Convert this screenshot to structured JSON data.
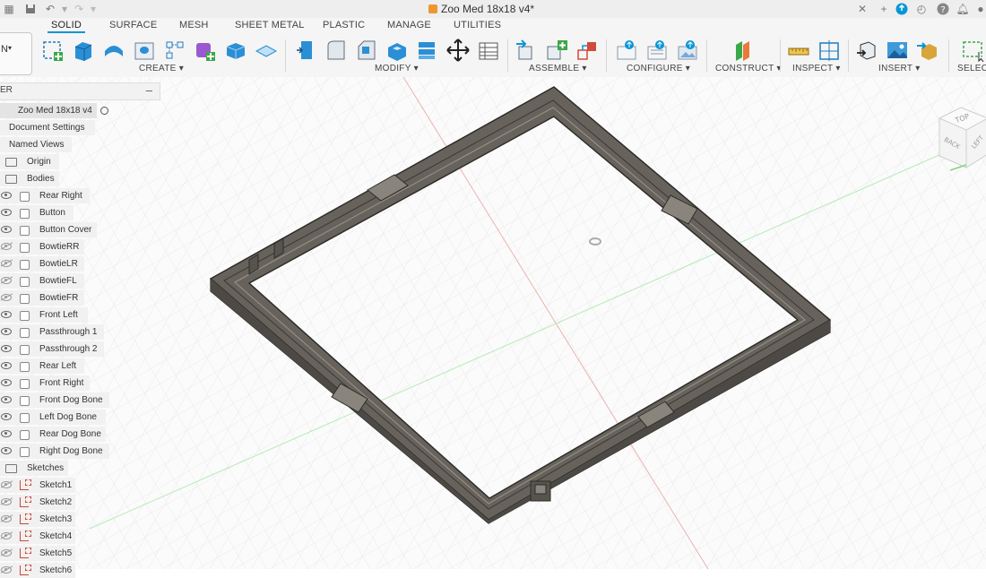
{
  "titlebar": {
    "document_title": "Zoo Med 18x18 v4*"
  },
  "tabs": [
    {
      "label": "SOLID",
      "active": true
    },
    {
      "label": "SURFACE"
    },
    {
      "label": "MESH"
    },
    {
      "label": "SHEET METAL"
    },
    {
      "label": "PLASTIC"
    },
    {
      "label": "MANAGE"
    },
    {
      "label": "UTILITIES"
    }
  ],
  "toolbar": {
    "workspace_label": "N",
    "groups": [
      {
        "label": "CREATE"
      },
      {
        "label": "MODIFY"
      },
      {
        "label": "ASSEMBLE"
      },
      {
        "label": "CONFIGURE"
      },
      {
        "label": "CONSTRUCT"
      },
      {
        "label": "INSPECT"
      },
      {
        "label": "INSERT"
      },
      {
        "label": "SELECT"
      }
    ]
  },
  "browser": {
    "header_label": "ER",
    "root": "Zoo Med 18x18 v4",
    "items": [
      {
        "label": "Document Settings"
      },
      {
        "label": "Named Views"
      },
      {
        "label": "Origin"
      },
      {
        "label": "Bodies"
      }
    ],
    "bodies": [
      {
        "label": "Rear Right",
        "visible": true
      },
      {
        "label": "Button",
        "visible": true
      },
      {
        "label": "Button Cover",
        "visible": true
      },
      {
        "label": "BowtieRR",
        "visible": false
      },
      {
        "label": "BowtieLR",
        "visible": false
      },
      {
        "label": "BowtieFL",
        "visible": false
      },
      {
        "label": "BowtieFR",
        "visible": false
      },
      {
        "label": "Front Left",
        "visible": true
      },
      {
        "label": "Passthrough 1",
        "visible": true
      },
      {
        "label": "Passthrough 2",
        "visible": true
      },
      {
        "label": "Rear Left",
        "visible": true
      },
      {
        "label": "Front Right",
        "visible": true
      },
      {
        "label": "Front Dog Bone",
        "visible": true
      },
      {
        "label": "Left Dog Bone",
        "visible": true
      },
      {
        "label": "Rear Dog Bone",
        "visible": true
      },
      {
        "label": "Right Dog Bone",
        "visible": true
      }
    ],
    "sketches_label": "Sketches",
    "sketches": [
      {
        "label": "Sketch1"
      },
      {
        "label": "Sketch2"
      },
      {
        "label": "Sketch3"
      },
      {
        "label": "Sketch4"
      },
      {
        "label": "Sketch5"
      },
      {
        "label": "Sketch6"
      }
    ]
  },
  "viewcube": {
    "faces": [
      "TOP",
      "BACK",
      "LEFT"
    ]
  },
  "colors": {
    "accent": "#0696d7",
    "frame_fill": "#6e6a63",
    "frame_edge": "#2e2c29",
    "x_axis": "#e8a0a0",
    "y_axis": "#a6e6a6"
  }
}
